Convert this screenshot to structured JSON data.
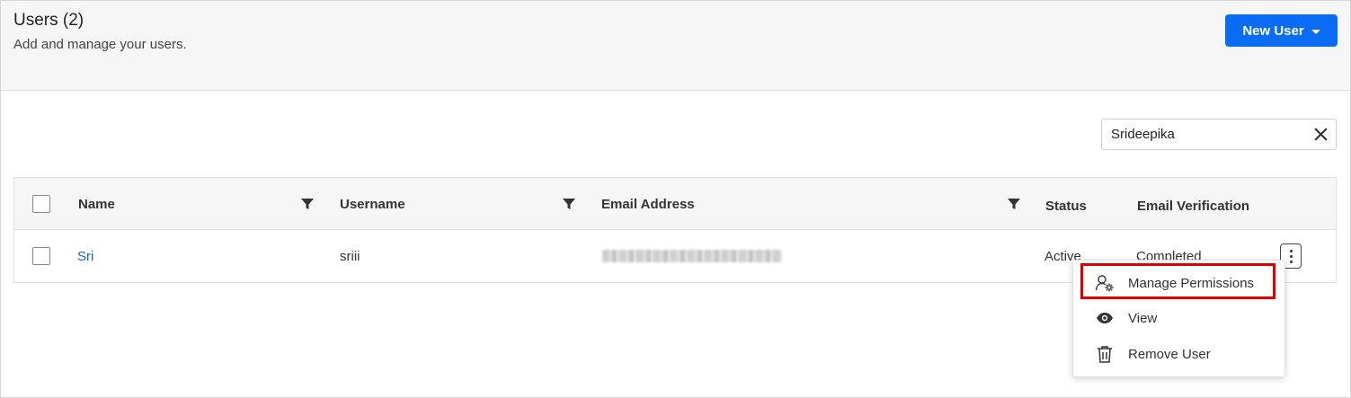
{
  "header": {
    "title": "Users (2)",
    "subtitle": "Add and manage your users.",
    "new_user_label": "New User"
  },
  "search": {
    "value": "Srideepika",
    "placeholder": ""
  },
  "table": {
    "columns": [
      "Name",
      "Username",
      "Email Address",
      "Status",
      "Email Verification"
    ],
    "rows": [
      {
        "name": "Sri",
        "username": "sriii",
        "email": "",
        "status": "Active",
        "email_verification": "Completed"
      }
    ]
  },
  "row_menu": {
    "items": [
      {
        "label": "Manage Permissions",
        "icon": "user-gear-icon"
      },
      {
        "label": "View",
        "icon": "eye-icon"
      },
      {
        "label": "Remove User",
        "icon": "trash-icon"
      }
    ]
  },
  "colors": {
    "primary": "#0a6cf5",
    "link": "#1565d8",
    "highlight": "#e10000"
  }
}
